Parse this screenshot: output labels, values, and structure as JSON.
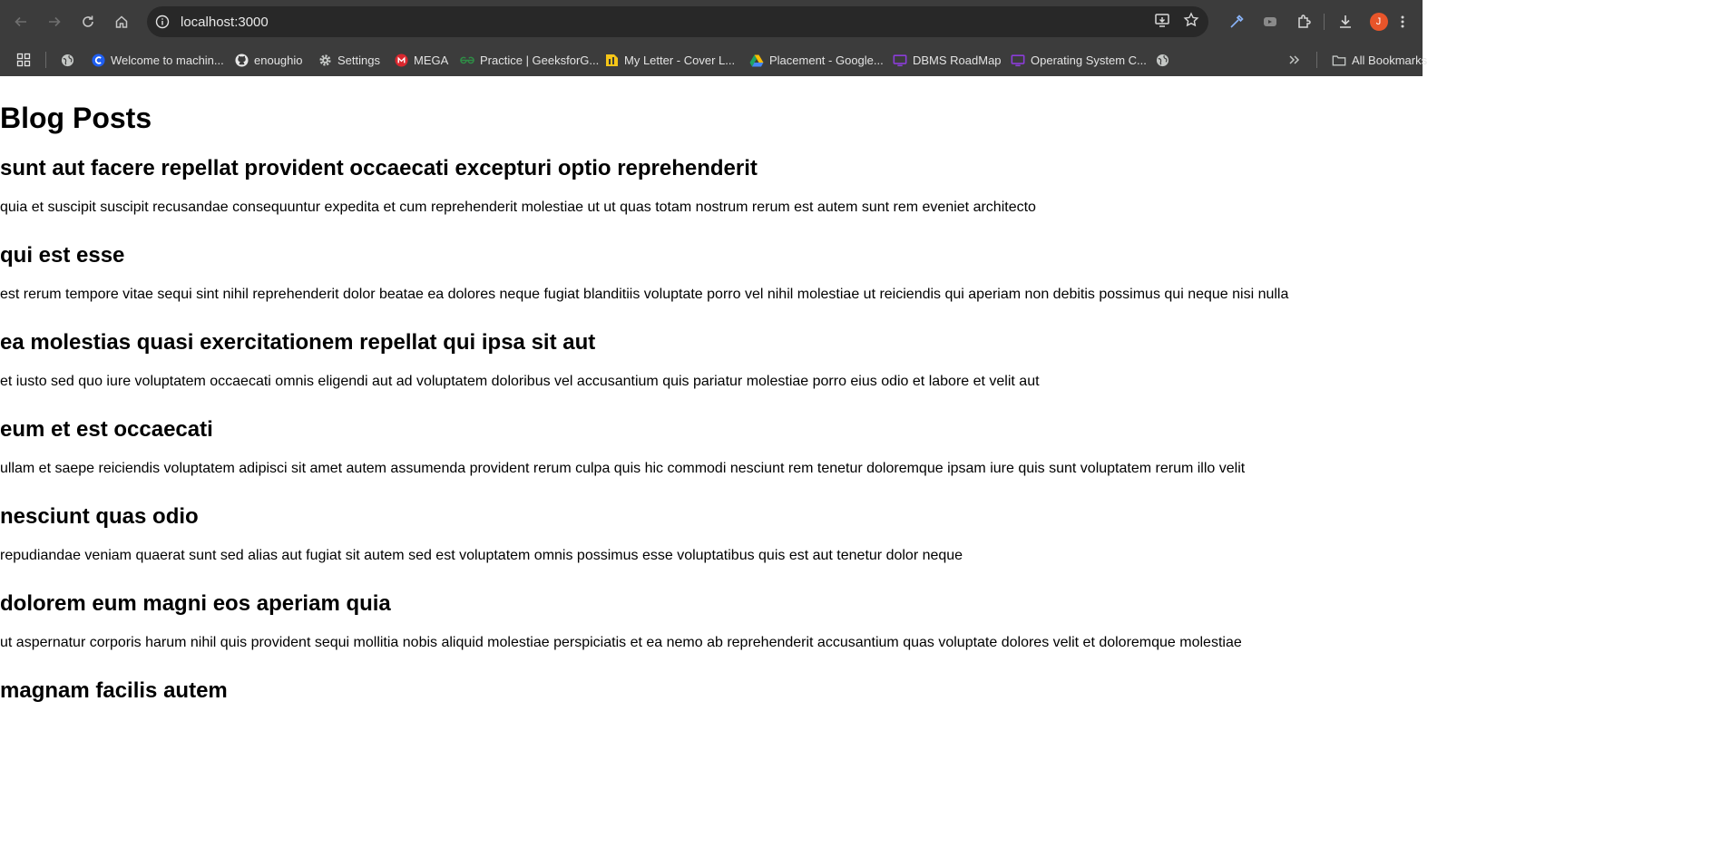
{
  "browser": {
    "url": "localhost:3000",
    "profile_initial": "J",
    "bookmarks": [
      {
        "label": "",
        "icon": "globe-icon"
      },
      {
        "label": "Welcome to machin...",
        "icon": "c-logo-icon"
      },
      {
        "label": "enoughio",
        "icon": "github-icon"
      },
      {
        "label": "Settings",
        "icon": "gear-icon"
      },
      {
        "label": "MEGA",
        "icon": "mega-icon"
      },
      {
        "label": "Practice | GeeksforG...",
        "icon": "gfg-icon"
      },
      {
        "label": "My Letter - Cover L...",
        "icon": "document-icon"
      },
      {
        "label": "Placement - Google...",
        "icon": "drive-icon"
      },
      {
        "label": "DBMS RoadMap",
        "icon": "monitor-icon"
      },
      {
        "label": "Operating System C...",
        "icon": "monitor-icon"
      },
      {
        "label": "",
        "icon": "globe-icon"
      }
    ],
    "all_bookmarks_label": "All Bookmarks"
  },
  "page": {
    "title": "Blog Posts",
    "posts": [
      {
        "title": "sunt aut facere repellat provident occaecati excepturi optio reprehenderit",
        "body": "quia et suscipit suscipit recusandae consequuntur expedita et cum reprehenderit molestiae ut ut quas totam nostrum rerum est autem sunt rem eveniet architecto"
      },
      {
        "title": "qui est esse",
        "body": "est rerum tempore vitae sequi sint nihil reprehenderit dolor beatae ea dolores neque fugiat blanditiis voluptate porro vel nihil molestiae ut reiciendis qui aperiam non debitis possimus qui neque nisi nulla"
      },
      {
        "title": "ea molestias quasi exercitationem repellat qui ipsa sit aut",
        "body": "et iusto sed quo iure voluptatem occaecati omnis eligendi aut ad voluptatem doloribus vel accusantium quis pariatur molestiae porro eius odio et labore et velit aut"
      },
      {
        "title": "eum et est occaecati",
        "body": "ullam et saepe reiciendis voluptatem adipisci sit amet autem assumenda provident rerum culpa quis hic commodi nesciunt rem tenetur doloremque ipsam iure quis sunt voluptatem rerum illo velit"
      },
      {
        "title": "nesciunt quas odio",
        "body": "repudiandae veniam quaerat sunt sed alias aut fugiat sit autem sed est voluptatem omnis possimus esse voluptatibus quis est aut tenetur dolor neque"
      },
      {
        "title": "dolorem eum magni eos aperiam quia",
        "body": "ut aspernatur corporis harum nihil quis provident sequi mollitia nobis aliquid molestiae perspiciatis et ea nemo ab reprehenderit accusantium quas voluptate dolores velit et doloremque molestiae"
      },
      {
        "title": "magnam facilis autem",
        "body": ""
      }
    ]
  }
}
